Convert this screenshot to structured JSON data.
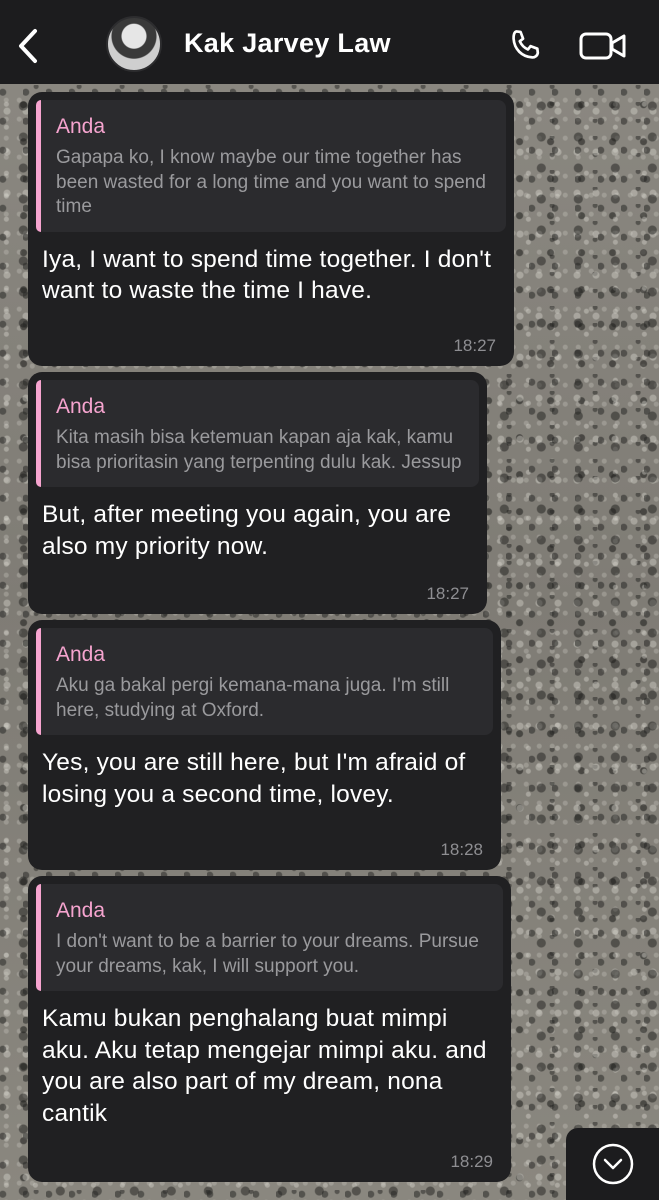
{
  "header": {
    "contact_name": "Kak Jarvey Law"
  },
  "icons": {
    "back": "chevron-left",
    "call": "phone",
    "video": "video-camera",
    "scroll": "chevron-down-circle"
  },
  "colors": {
    "header_bg": "#1c1c1e",
    "bubble_bg": "#202022",
    "quote_bg": "#2b2b2e",
    "quote_accent": "#f6a4cf",
    "text": "#ffffff",
    "muted": "#8e8e92"
  },
  "messages": [
    {
      "quote_author": "Anda",
      "quote_text": "Gapapa ko, I know maybe our time together has been wasted for a long time and you want to spend time",
      "text": "Iya, I want to spend time together. I don't want to waste the time I have.",
      "time": "18:27"
    },
    {
      "quote_author": "Anda",
      "quote_text": "Kita masih bisa ketemuan kapan aja kak, kamu bisa prioritasin yang terpenting dulu kak. Jessup",
      "text": "But, after meeting you again, you are also my priority now.",
      "time": "18:27"
    },
    {
      "quote_author": "Anda",
      "quote_text": "Aku ga bakal pergi kemana-mana juga. I'm still here, studying at Oxford.",
      "text": "Yes, you are still here, but I'm afraid of losing you a second time, lovey.",
      "time": "18:28"
    },
    {
      "quote_author": "Anda",
      "quote_text": "I don't want to be a barrier to your dreams. Pursue your dreams, kak, I will support you.",
      "text": "Kamu bukan penghalang buat mimpi aku. Aku tetap mengejar mimpi aku. and you are also part of my dream, nona cantik",
      "time": "18:29"
    }
  ]
}
